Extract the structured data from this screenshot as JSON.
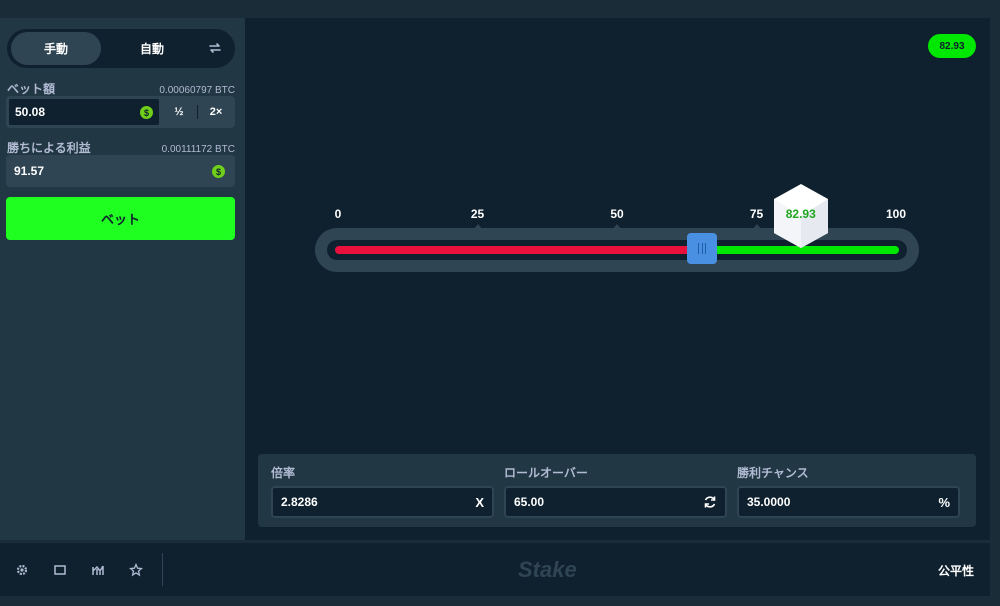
{
  "sidebar": {
    "mode_manual": "手動",
    "mode_auto": "自動",
    "bet_amount_label": "ベット額",
    "bet_amount_btc": "0.00060797 BTC",
    "bet_amount_value": "50.08",
    "half_label": "½",
    "double_label": "2×",
    "profit_label": "勝ちによる利益",
    "profit_btc": "0.00111172 BTC",
    "profit_value": "91.57",
    "bet_button": "ベット",
    "currency_symbol": "$"
  },
  "game": {
    "last_result": "82.93",
    "scale_labels": [
      "0",
      "25",
      "50",
      "75",
      "100"
    ],
    "roll_over_value": 65,
    "dice_result": "82.93",
    "lose_color": "#e9113c",
    "win_color": "#00e701"
  },
  "stats": {
    "multiplier_label": "倍率",
    "multiplier_value": "2.8286",
    "multiplier_icon": "X",
    "rollover_label": "ロールオーバー",
    "rollover_value": "65.00",
    "win_chance_label": "勝利チャンス",
    "win_chance_value": "35.0000",
    "win_chance_icon": "%"
  },
  "footer": {
    "logo": "Stake",
    "fairness": "公平性"
  },
  "colors": {
    "accent_green": "#1fff20",
    "slider_handle": "#4a90e2"
  }
}
